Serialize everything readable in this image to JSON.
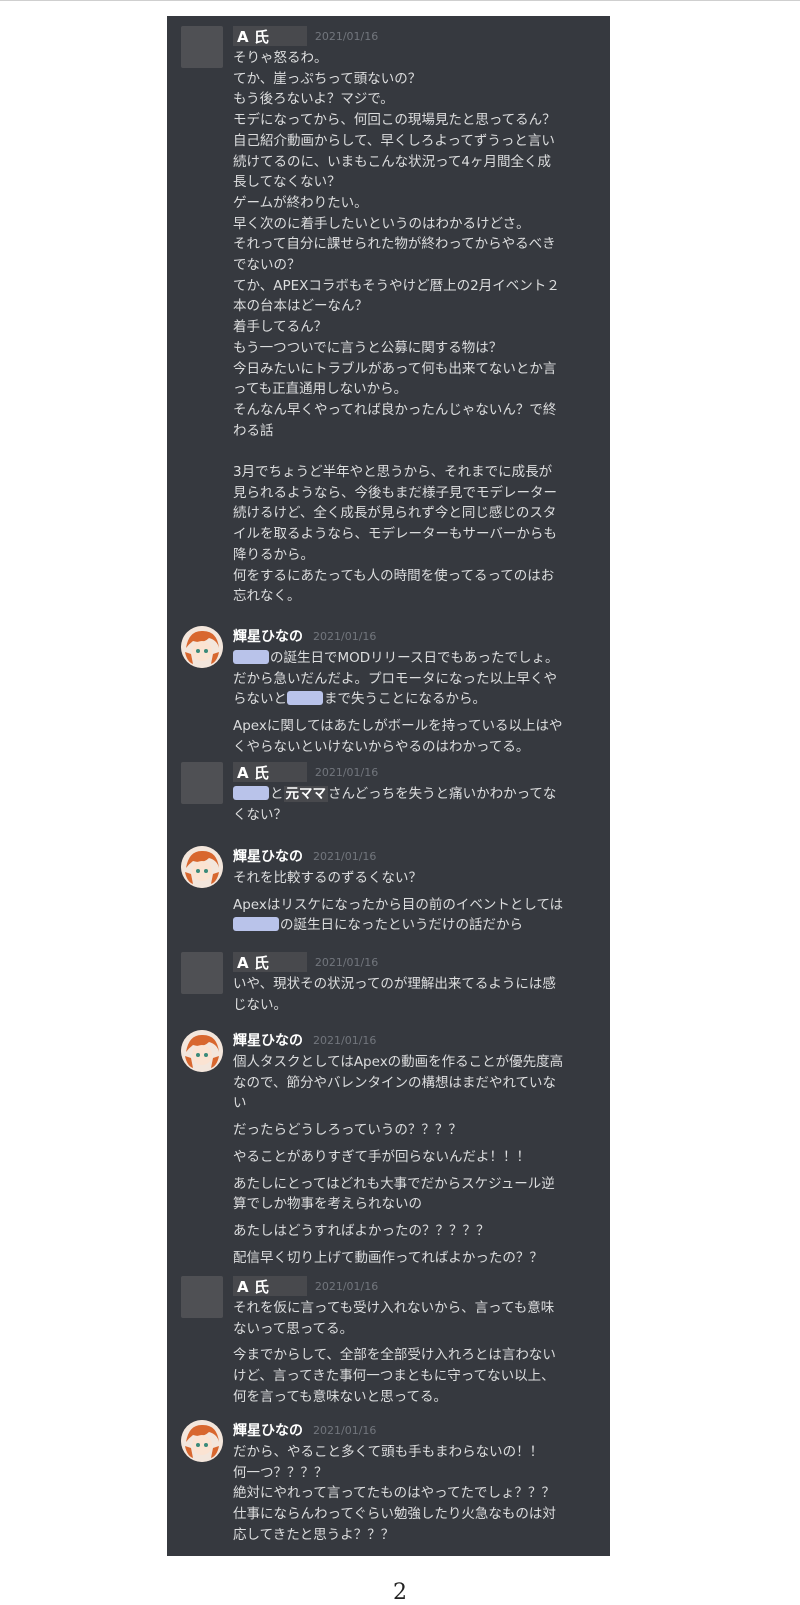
{
  "messages": [
    {
      "author": "A 氏",
      "timestamp": "2021/01/16",
      "lines": [
        "そりゃ怒るわ。",
        "てか、崖っぷちって頭ないの？",
        "もう後ろないよ？マジで。",
        "モデになってから、何回この現場見たと思ってるん？",
        "自己紹介動画からして、早くしろよってずうっと言い",
        "続けてるのに、いまもこんな状況って4ヶ月間全く成",
        "長してなくない？",
        "ゲームが終わりたい。",
        "早く次のに着手したいというのはわかるけどさ。",
        "それって自分に課せられた物が終わってからやるべき",
        "でないの？",
        "てか、APEXコラボもそうやけど暦上の2月イベント２",
        "本の台本はどーなん？",
        "着手してるん？",
        "もう一つついでに言うと公募に関する物は？",
        "今日みたいにトラブルがあって何も出来てないとか言",
        "っても正直通用しないから。",
        "そんなん早くやってれば良かったんじゃないん？で終",
        "わる話",
        "",
        "3月でちょうど半年やと思うから、それまでに成長が",
        "見られるようなら、今後もまだ様子見でモデレーター",
        "続けるけど、全く成長が見られず今と同じ感じのスタ",
        "イルを取るようなら、モデレーターもサーバーからも",
        "降りるから。",
        "何をするにあたっても人の時間を使ってるってのはお",
        "忘れなく。"
      ]
    },
    {
      "author": "輝星ひなの",
      "timestamp": "2021/01/16",
      "l1": "の誕生日でMODリリース日でもあったでしょ。",
      "l2": "だから急いだんだよ。プロモータになった以上早くや",
      "l3a": "らないと",
      "l3b": "まで失うことになるから。",
      "l4": "Apexに関してはあたしがボールを持っている以上はや",
      "l5": "くやらないといけないからやるのはわかってる。"
    },
    {
      "author": "A 氏",
      "timestamp": "2021/01/16",
      "l1a": "と",
      "l1b": "元ママ",
      "l1c": "さんどっちを失うと痛いかわかってな",
      "l2": "くない？"
    },
    {
      "author": "輝星ひなの",
      "timestamp": "2021/01/16",
      "l1": "それを比較するのずるくない？",
      "l2": "Apexはリスケになったから目の前のイベントとしては",
      "l3": "の誕生日になったというだけの話だから"
    },
    {
      "author": "A 氏",
      "timestamp": "2021/01/16",
      "lines": [
        "いや、現状その状況ってのが理解出来てるようには感",
        "じない。"
      ]
    },
    {
      "author": "輝星ひなの",
      "timestamp": "2021/01/16",
      "lines": [
        "個人タスクとしてはApexの動画を作ることが優先度高",
        "なので、節分やバレンタインの構想はまだやれていな",
        "い",
        "だったらどうしろっていうの？？？？",
        "やることがありすぎて手が回らないんだよ！！！",
        "あたしにとってはどれも大事でだからスケジュール逆",
        "算でしか物事を考えられないの",
        "あたしはどうすればよかったの？？？？？",
        "配信早く切り上げて動画作ってればよかったの？？"
      ]
    },
    {
      "author": "A 氏",
      "timestamp": "2021/01/16",
      "lines": [
        "それを仮に言っても受け入れないから、言っても意味",
        "ないって思ってる。",
        "今までからして、全部を全部受け入れろとは言わない",
        "けど、言ってきた事何一つまともに守ってない以上、",
        "何を言っても意味ないと思ってる。"
      ]
    },
    {
      "author": "輝星ひなの",
      "timestamp": "2021/01/16",
      "lines": [
        "だから、やること多くて頭も手もまわらないの！！",
        "何一つ？？？？",
        "絶対にやれって言ってたものはやってたでしょ？？？",
        "仕事にならんわってぐらい勉強したり火急なものは対",
        "応してきたと思うよ？？？"
      ]
    }
  ],
  "page_number": "2"
}
